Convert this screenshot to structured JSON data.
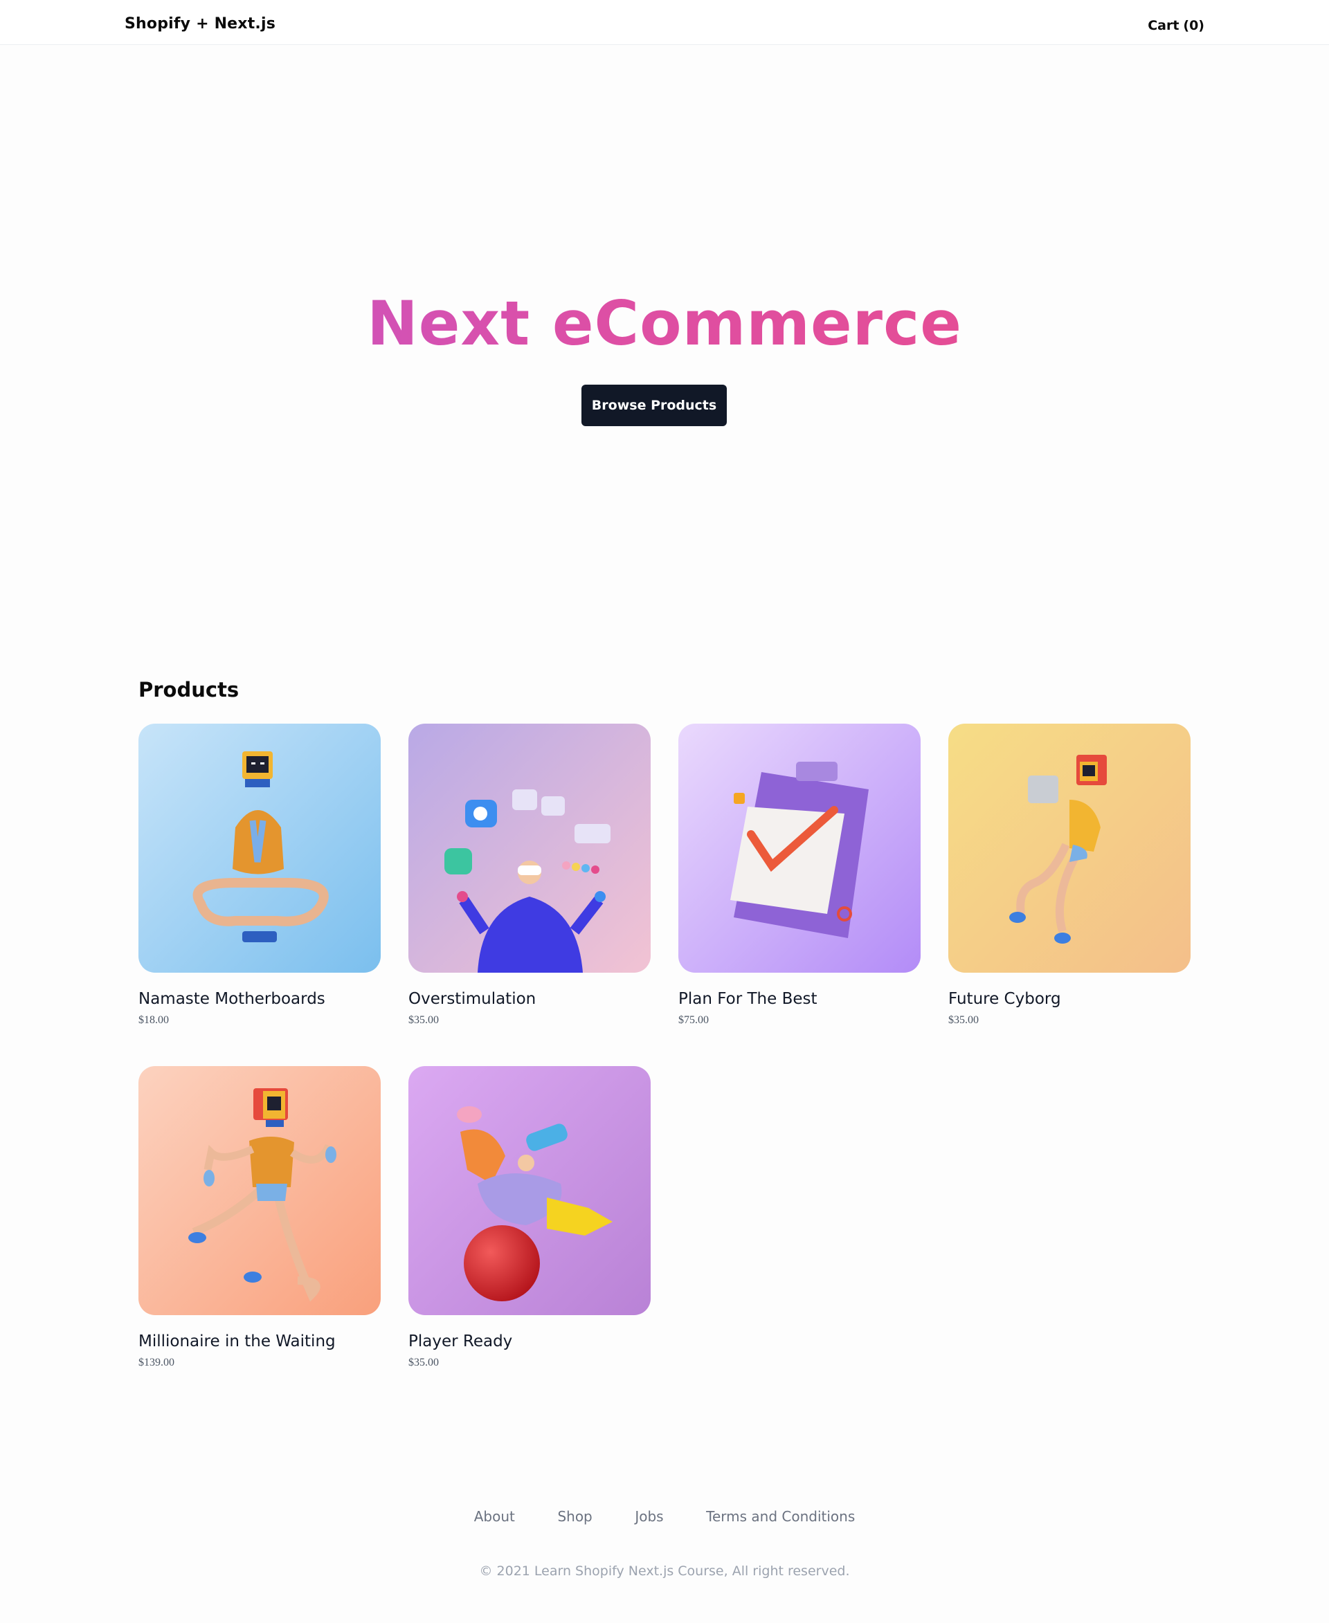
{
  "header": {
    "brand": "Shopify + Next.js",
    "cart_label": "Cart",
    "cart_count": "(0)"
  },
  "hero": {
    "title": "Next eCommerce",
    "button": "Browse Products",
    "gradient_colors": [
      "#c057d0",
      "#ec4b86"
    ]
  },
  "products": {
    "heading": "Products",
    "items": [
      {
        "name": "Namaste Motherboards",
        "price": "$18.00",
        "image": "meditating-robot-illustration",
        "bg": [
          "#c7e4f9",
          "#7bbfee"
        ]
      },
      {
        "name": "Overstimulation",
        "price": "$35.00",
        "image": "vr-juggler-illustration",
        "bg": [
          "#b9a9e6",
          "#f2c3d3"
        ]
      },
      {
        "name": "Plan For The Best",
        "price": "$75.00",
        "image": "clipboard-checkmark-illustration",
        "bg": [
          "#ead9fd",
          "#b38cf7"
        ]
      },
      {
        "name": "Future Cyborg",
        "price": "$35.00",
        "image": "flying-cyborg-illustration",
        "bg": [
          "#f6dd86",
          "#f4bf8a"
        ]
      },
      {
        "name": "Millionaire in the Waiting",
        "price": "$139.00",
        "image": "running-robot-illustration",
        "bg": [
          "#fcd2bf",
          "#f9a07c"
        ]
      },
      {
        "name": "Player Ready",
        "price": "$35.00",
        "image": "gamer-on-ball-illustration",
        "bg": [
          "#dba9f2",
          "#b982d6"
        ]
      }
    ]
  },
  "footer": {
    "links": [
      "About",
      "Shop",
      "Jobs",
      "Terms and Conditions"
    ],
    "copyright": "© 2021 Learn Shopify Next.js Course, All right reserved."
  }
}
